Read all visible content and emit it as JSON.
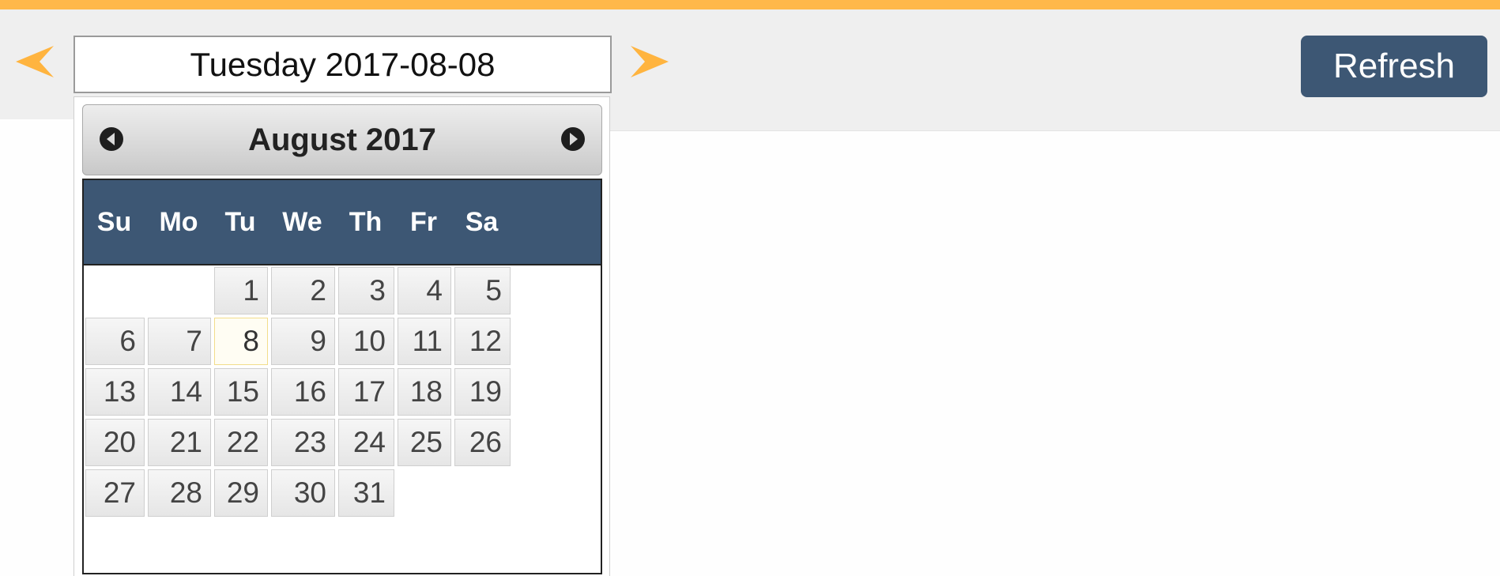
{
  "toolbar": {
    "date_value": "Tuesday 2017-08-08",
    "refresh_label": "Refresh",
    "prev_icon": "arrow-left-icon",
    "next_icon": "arrow-right-icon"
  },
  "datepicker": {
    "month_title": "August 2017",
    "prev_icon": "circle-arrow-left-icon",
    "next_icon": "circle-arrow-right-icon",
    "day_names": [
      "Su",
      "Mo",
      "Tu",
      "We",
      "Th",
      "Fr",
      "Sa"
    ],
    "weeks": [
      [
        "",
        "",
        "1",
        "2",
        "3",
        "4",
        "5"
      ],
      [
        "6",
        "7",
        "8",
        "9",
        "10",
        "11",
        "12"
      ],
      [
        "13",
        "14",
        "15",
        "16",
        "17",
        "18",
        "19"
      ],
      [
        "20",
        "21",
        "22",
        "23",
        "24",
        "25",
        "26"
      ],
      [
        "27",
        "28",
        "29",
        "30",
        "31",
        "",
        ""
      ]
    ],
    "selected_day": "8"
  },
  "colors": {
    "accent": "#ffb84a",
    "header_blue": "#3d5774",
    "toolbar_bg": "#efefef"
  }
}
